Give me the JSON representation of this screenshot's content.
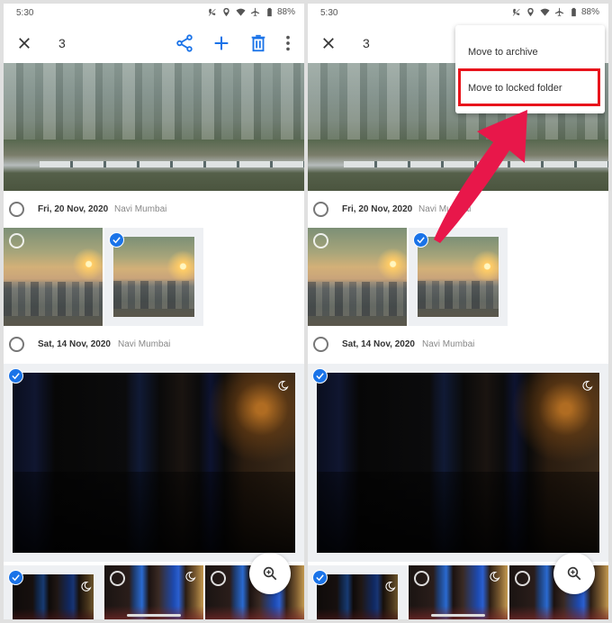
{
  "status_bar": {
    "time": "5:30",
    "battery": "88%",
    "icons": [
      "call-muted-icon",
      "location-icon",
      "wifi-icon",
      "airplane-icon",
      "battery-icon"
    ]
  },
  "app_bar": {
    "selected_count": "3",
    "actions": [
      "share-icon",
      "add-icon",
      "delete-icon",
      "more-vert-icon"
    ]
  },
  "groups": [
    {
      "date": "Fri, 20 Nov, 2020",
      "place": "Navi Mumbai"
    },
    {
      "date": "Sat, 14 Nov, 2020",
      "place": "Navi Mumbai"
    }
  ],
  "menu": {
    "items": [
      {
        "label": "Move to archive"
      },
      {
        "label": "Move to locked folder",
        "highlighted": true
      }
    ]
  },
  "annotation": {
    "highlight_color": "#e8141c",
    "arrow_color": "#e8174a"
  },
  "colors": {
    "accent": "#1a73e8"
  }
}
